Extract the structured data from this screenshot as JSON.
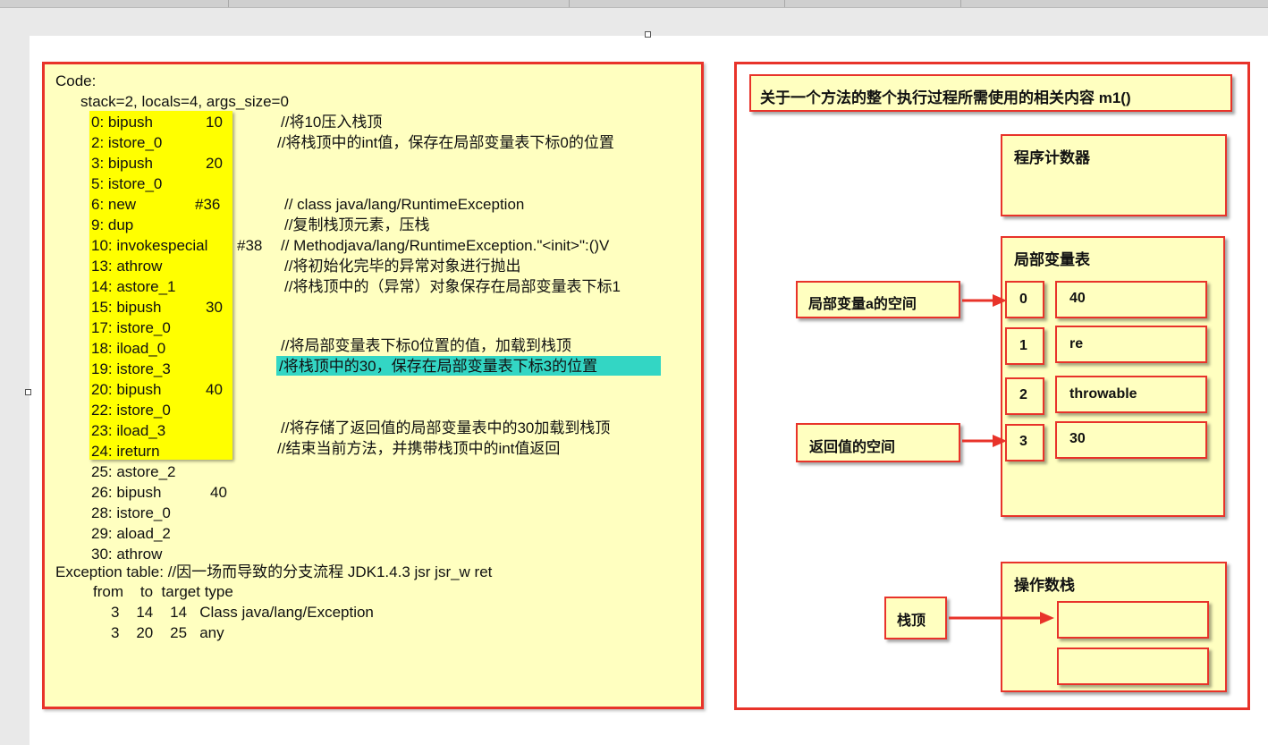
{
  "code_panel": {
    "title": "Code:",
    "stack_info": "stack=2, locals=4, args_size=0",
    "instructions": [
      {
        "op": "0: bipush",
        "arg": "10"
      },
      {
        "op": "2: istore_0",
        "arg": ""
      },
      {
        "op": "3: bipush",
        "arg": "20"
      },
      {
        "op": "5: istore_0",
        "arg": ""
      },
      {
        "op": "6: new",
        "arg": "#36"
      },
      {
        "op": "9: dup",
        "arg": ""
      },
      {
        "op": "10: invokespecial",
        "arg": "#38"
      },
      {
        "op": "13: athrow",
        "arg": ""
      },
      {
        "op": "14: astore_1",
        "arg": ""
      },
      {
        "op": "15: bipush",
        "arg": "30"
      },
      {
        "op": "17: istore_0",
        "arg": ""
      },
      {
        "op": "18: iload_0",
        "arg": ""
      },
      {
        "op": "19: istore_3",
        "arg": ""
      },
      {
        "op": "20: bipush",
        "arg": "40"
      },
      {
        "op": "22: istore_0",
        "arg": ""
      },
      {
        "op": "23: iload_3",
        "arg": ""
      },
      {
        "op": "24: ireturn",
        "arg": ""
      },
      {
        "op": "25: astore_2",
        "arg": ""
      },
      {
        "op": "26: bipush",
        "arg": "40"
      },
      {
        "op": "28: istore_0",
        "arg": ""
      },
      {
        "op": "29: aload_2",
        "arg": ""
      },
      {
        "op": "30: athrow",
        "arg": ""
      }
    ],
    "comments": {
      "c0": "//将10压入栈顶",
      "c1": "//将栈顶中的int值，保存在局部变量表下标0的位置",
      "c4": "// class java/lang/RuntimeException",
      "c5": "//复制栈顶元素，压栈",
      "c6": "// Methodjava/lang/RuntimeException.\"<init>\":()V",
      "c7": "//将初始化完毕的异常对象进行抛出",
      "c8": "//将栈顶中的（异常）对象保存在局部变量表下标1",
      "c11": "//将局部变量表下标0位置的值，加载到栈顶",
      "c12": "/将栈顶中的30，保存在局部变量表下标3的位置",
      "c15": "//将存储了返回值的局部变量表中的30加载到栈顶",
      "c16": "//结束当前方法，并携带栈顶中的int值返回"
    },
    "exception_table": {
      "title": "Exception table: //因一场而导致的分支流程  JDK1.4.3   jsr  jsr_w ret",
      "header": "from    to  target type",
      "rows": [
        "3    14    14   Class java/lang/Exception",
        "3    20    25   any"
      ]
    }
  },
  "frame_panel": {
    "title": "关于一个方法的整个执行过程所需使用的相关内容 m1()",
    "program_counter": "程序计数器",
    "local_vars": {
      "title": "局部变量表",
      "slots": [
        {
          "index": "0",
          "value": "40"
        },
        {
          "index": "1",
          "value": "re"
        },
        {
          "index": "2",
          "value": "throwable"
        },
        {
          "index": "3",
          "value": "30"
        }
      ]
    },
    "callout_a": "局部变量a的空间",
    "callout_return": "返回值的空间",
    "operand_stack": "操作数栈",
    "stack_top": "栈顶"
  },
  "colors": {
    "border_red": "#e8332a",
    "box_yellow": "#ffffc0",
    "highlight_yellow": "#ffff00",
    "highlight_cyan": "#33d6c4"
  }
}
